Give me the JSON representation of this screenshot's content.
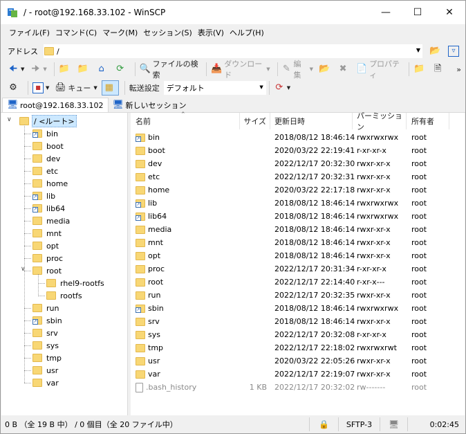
{
  "window": {
    "title": "/ - root@192.168.33.102 - WinSCP"
  },
  "menu": [
    "ファイル(F)",
    "コマンド(C)",
    "マーク(M)",
    "セッション(S)",
    "表示(V)",
    "ヘルプ(H)"
  ],
  "address": {
    "label": "アドレス",
    "value": "/"
  },
  "toolbar1": {
    "find_files": "ファイルの検索",
    "download": "ダウンロード",
    "edit": "編集",
    "properties": "プロパティ"
  },
  "toolbar2": {
    "queue": "キュー",
    "transfer_settings_label": "転送設定",
    "transfer_settings_value": "デフォルト"
  },
  "tabs": {
    "session": "root@192.168.33.102",
    "new_session": "新しいセッション"
  },
  "tree": {
    "root": "/ <ルート>",
    "items": [
      {
        "name": "bin",
        "link": true
      },
      {
        "name": "boot",
        "link": false
      },
      {
        "name": "dev",
        "link": false
      },
      {
        "name": "etc",
        "link": false
      },
      {
        "name": "home",
        "link": false
      },
      {
        "name": "lib",
        "link": true
      },
      {
        "name": "lib64",
        "link": true
      },
      {
        "name": "media",
        "link": false
      },
      {
        "name": "mnt",
        "link": false
      },
      {
        "name": "opt",
        "link": false
      },
      {
        "name": "proc",
        "link": false
      },
      {
        "name": "root",
        "link": false
      },
      {
        "name": "run",
        "link": false
      },
      {
        "name": "sbin",
        "link": true
      },
      {
        "name": "srv",
        "link": false
      },
      {
        "name": "sys",
        "link": false
      },
      {
        "name": "tmp",
        "link": false
      },
      {
        "name": "usr",
        "link": false
      },
      {
        "name": "var",
        "link": false
      }
    ],
    "root_children": [
      "rhel9-rootfs",
      "rootfs"
    ]
  },
  "list": {
    "headers": {
      "name": "名前",
      "size": "サイズ",
      "modified": "更新日時",
      "permissions": "パーミッション",
      "owner": "所有者"
    },
    "rows": [
      {
        "name": "bin",
        "size": "",
        "modified": "2018/08/12 18:46:14",
        "perm": "rwxrwxrwx",
        "owner": "root",
        "link": true,
        "file": false
      },
      {
        "name": "boot",
        "size": "",
        "modified": "2020/03/22 22:19:41",
        "perm": "r-xr-xr-x",
        "owner": "root",
        "link": false,
        "file": false
      },
      {
        "name": "dev",
        "size": "",
        "modified": "2022/12/17 20:32:30",
        "perm": "rwxr-xr-x",
        "owner": "root",
        "link": false,
        "file": false
      },
      {
        "name": "etc",
        "size": "",
        "modified": "2022/12/17 20:32:31",
        "perm": "rwxr-xr-x",
        "owner": "root",
        "link": false,
        "file": false
      },
      {
        "name": "home",
        "size": "",
        "modified": "2020/03/22 22:17:18",
        "perm": "rwxr-xr-x",
        "owner": "root",
        "link": false,
        "file": false
      },
      {
        "name": "lib",
        "size": "",
        "modified": "2018/08/12 18:46:14",
        "perm": "rwxrwxrwx",
        "owner": "root",
        "link": true,
        "file": false
      },
      {
        "name": "lib64",
        "size": "",
        "modified": "2018/08/12 18:46:14",
        "perm": "rwxrwxrwx",
        "owner": "root",
        "link": true,
        "file": false
      },
      {
        "name": "media",
        "size": "",
        "modified": "2018/08/12 18:46:14",
        "perm": "rwxr-xr-x",
        "owner": "root",
        "link": false,
        "file": false
      },
      {
        "name": "mnt",
        "size": "",
        "modified": "2018/08/12 18:46:14",
        "perm": "rwxr-xr-x",
        "owner": "root",
        "link": false,
        "file": false
      },
      {
        "name": "opt",
        "size": "",
        "modified": "2018/08/12 18:46:14",
        "perm": "rwxr-xr-x",
        "owner": "root",
        "link": false,
        "file": false
      },
      {
        "name": "proc",
        "size": "",
        "modified": "2022/12/17 20:31:34",
        "perm": "r-xr-xr-x",
        "owner": "root",
        "link": false,
        "file": false
      },
      {
        "name": "root",
        "size": "",
        "modified": "2022/12/17 22:14:40",
        "perm": "r-xr-x---",
        "owner": "root",
        "link": false,
        "file": false
      },
      {
        "name": "run",
        "size": "",
        "modified": "2022/12/17 20:32:35",
        "perm": "rwxr-xr-x",
        "owner": "root",
        "link": false,
        "file": false
      },
      {
        "name": "sbin",
        "size": "",
        "modified": "2018/08/12 18:46:14",
        "perm": "rwxrwxrwx",
        "owner": "root",
        "link": true,
        "file": false
      },
      {
        "name": "srv",
        "size": "",
        "modified": "2018/08/12 18:46:14",
        "perm": "rwxr-xr-x",
        "owner": "root",
        "link": false,
        "file": false
      },
      {
        "name": "sys",
        "size": "",
        "modified": "2022/12/17 20:32:08",
        "perm": "r-xr-xr-x",
        "owner": "root",
        "link": false,
        "file": false
      },
      {
        "name": "tmp",
        "size": "",
        "modified": "2022/12/17 22:18:02",
        "perm": "rwxrwxrwt",
        "owner": "root",
        "link": false,
        "file": false
      },
      {
        "name": "usr",
        "size": "",
        "modified": "2020/03/22 22:05:26",
        "perm": "rwxr-xr-x",
        "owner": "root",
        "link": false,
        "file": false
      },
      {
        "name": "var",
        "size": "",
        "modified": "2022/12/17 22:19:07",
        "perm": "rwxr-xr-x",
        "owner": "root",
        "link": false,
        "file": false
      },
      {
        "name": ".bash_history",
        "size": "1 KB",
        "modified": "2022/12/17 20:32:02",
        "perm": "rw-------",
        "owner": "root",
        "link": false,
        "file": true
      }
    ]
  },
  "status": {
    "selection": "0 B （全 19 B 中） / 0 個目（全 20 ファイル中）",
    "protocol": "SFTP-3",
    "elapsed": "0:02:45"
  },
  "colors": {
    "folder": "#f8d775",
    "selection": "#cce8ff",
    "accent_blue": "#1e64c8"
  }
}
